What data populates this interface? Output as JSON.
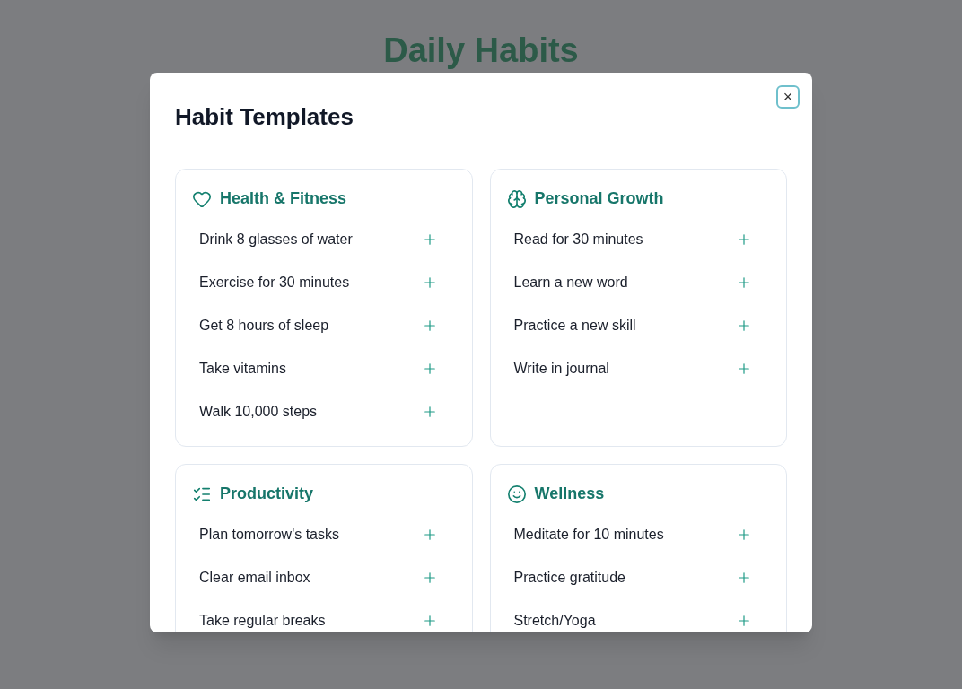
{
  "page_title": "Daily Habits",
  "dialog": {
    "title": "Habit Templates",
    "close_label": "×"
  },
  "categories": [
    {
      "name": "Health & Fitness",
      "kind": "heart",
      "habits": [
        "Drink 8 glasses of water",
        "Exercise for 30 minutes",
        "Get 8 hours of sleep",
        "Take vitamins",
        "Walk 10,000 steps"
      ]
    },
    {
      "name": "Personal Growth",
      "kind": "brain",
      "habits": [
        "Read for 30 minutes",
        "Learn a new word",
        "Practice a new skill",
        "Write in journal"
      ]
    },
    {
      "name": "Productivity",
      "kind": "checklist",
      "habits": [
        "Plan tomorrow's tasks",
        "Clear email inbox",
        "Take regular breaks"
      ]
    },
    {
      "name": "Wellness",
      "kind": "smile",
      "habits": [
        "Meditate for 10 minutes",
        "Practice gratitude",
        "Stretch/Yoga"
      ]
    }
  ]
}
